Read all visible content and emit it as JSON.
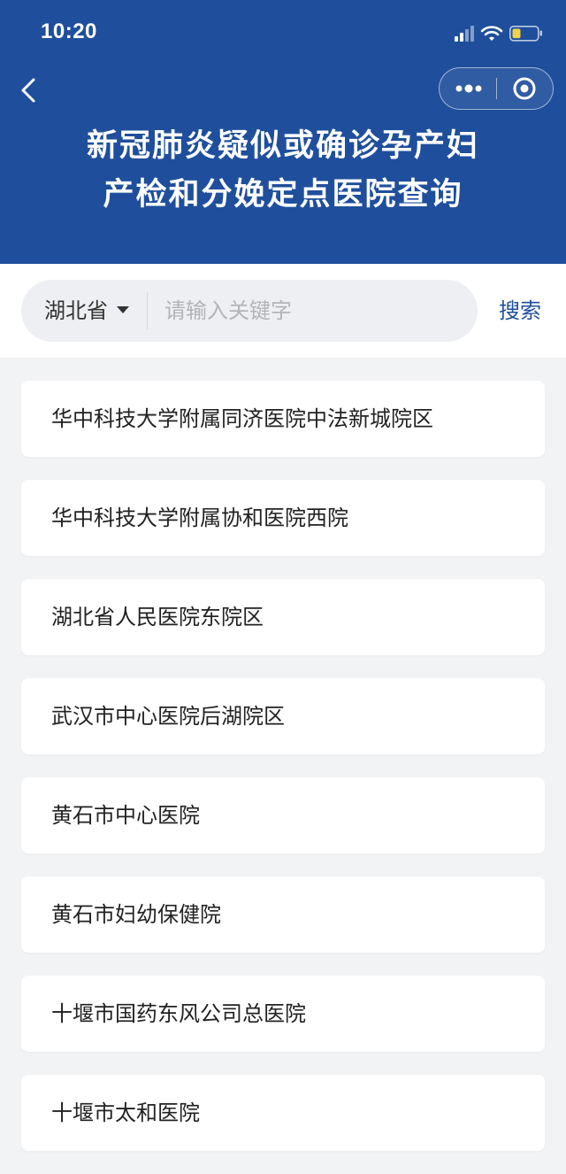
{
  "status_bar": {
    "time": "10:20"
  },
  "colors": {
    "header_bg": "#1f4f9c",
    "page_bg": "#f2f3f5",
    "accent": "#1f4f9c",
    "battery": "#f2d348"
  },
  "navigation": {
    "back_icon": "chevron-left-icon",
    "more_icon": "more-dots-icon",
    "close_icon": "target-circle-icon"
  },
  "header": {
    "title_line1": "新冠肺炎疑似或确诊孕产妇",
    "title_line2": "产检和分娩定点医院查询"
  },
  "search": {
    "province": "湖北省",
    "keyword_placeholder": "请输入关键字",
    "keyword_value": "",
    "button_label": "搜索"
  },
  "hospitals": [
    {
      "name": "华中科技大学附属同济医院中法新城院区"
    },
    {
      "name": "华中科技大学附属协和医院西院"
    },
    {
      "name": "湖北省人民医院东院区"
    },
    {
      "name": "武汉市中心医院后湖院区"
    },
    {
      "name": "黄石市中心医院"
    },
    {
      "name": "黄石市妇幼保健院"
    },
    {
      "name": "十堰市国药东风公司总医院"
    },
    {
      "name": "十堰市太和医院"
    }
  ]
}
